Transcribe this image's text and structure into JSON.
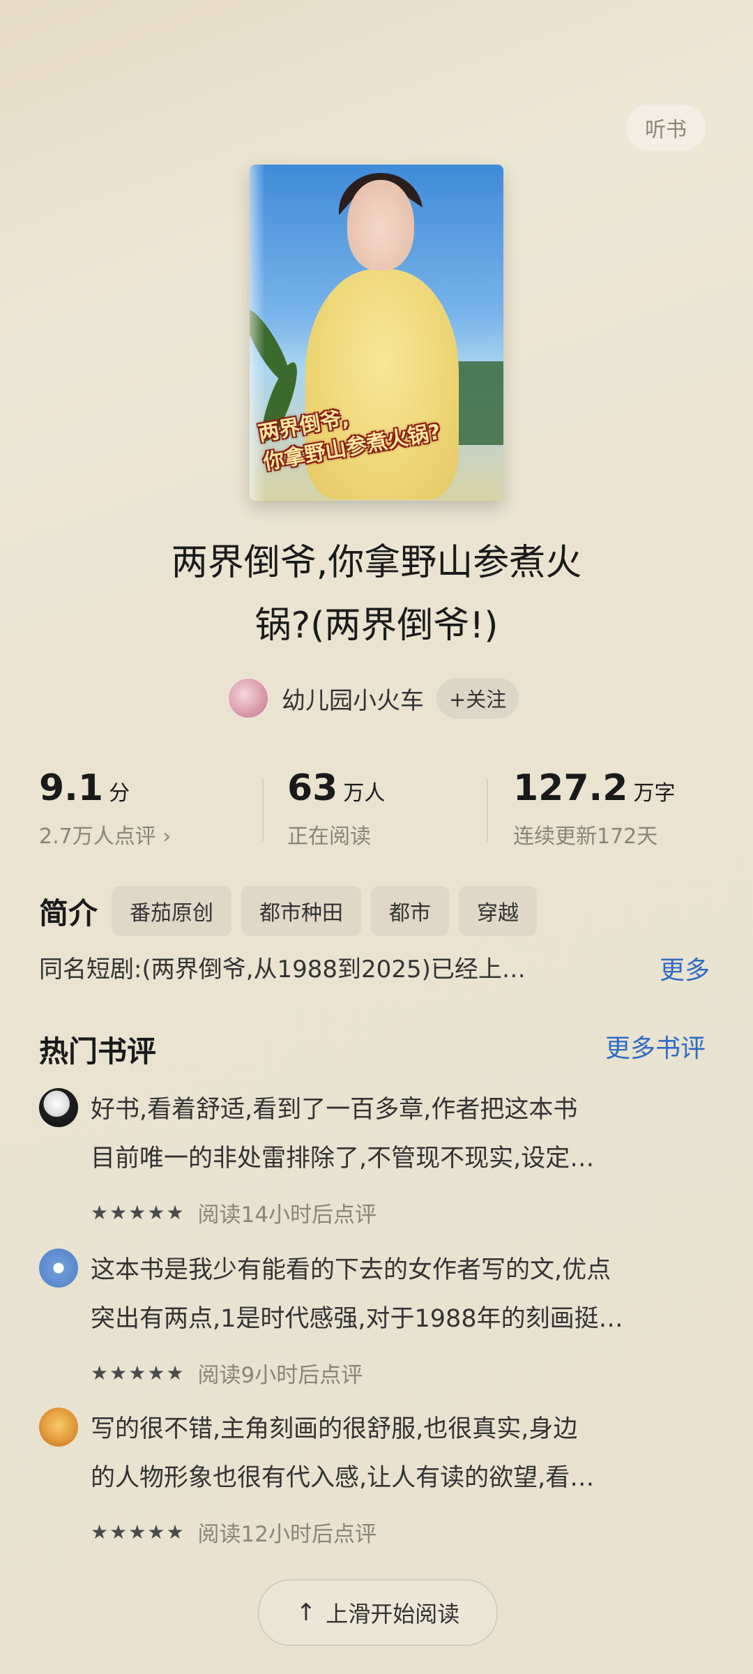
{
  "header": {
    "listen_label": "听书"
  },
  "cover": {
    "line1": "两界倒爷,",
    "line2": "你拿野山参煮火锅?"
  },
  "book": {
    "title_line1": "两界倒爷,你拿野山参煮火",
    "title_line2": "锅?(两界倒爷!)"
  },
  "author": {
    "name": "幼儿园小火车",
    "follow_label": "+关注"
  },
  "stats": {
    "rating": {
      "value": "9.1",
      "unit": "分",
      "sub": "2.7万人点评 ›"
    },
    "readers": {
      "value": "63",
      "unit": "万人",
      "sub": "正在阅读"
    },
    "words": {
      "value": "127.2",
      "unit": "万字",
      "sub": "连续更新172天"
    }
  },
  "intro": {
    "label": "简介",
    "tags": [
      "番茄原创",
      "都市种田",
      "都市",
      "穿越"
    ],
    "summary": "同名短剧:(两界倒爷,从1988到2025)已经上…",
    "more_label": "更多"
  },
  "reviews": {
    "section_title": "热门书评",
    "more_label": "更多书评",
    "items": [
      {
        "line1": "好书,看着舒适,看到了一百多章,作者把这本书",
        "line2": "目前唯一的非处雷排除了,不管现不现实,设定…",
        "meta": "阅读14小时后点评",
        "stars": 5
      },
      {
        "line1": "这本书是我少有能看的下去的女作者写的文,优点",
        "line2": "突出有两点,1是时代感强,对于1988年的刻画挺…",
        "meta": "阅读9小时后点评",
        "stars": 5
      },
      {
        "line1": "写的很不错,主角刻画的很舒服,也很真实,身边",
        "line2": "的人物形象也很有代入感,让人有读的欲望,看…",
        "meta": "阅读12小时后点评",
        "stars": 5
      }
    ]
  },
  "bottom": {
    "read_label": "上滑开始阅读"
  },
  "icons": {
    "star": "star-icon",
    "arrow": "arrow-up-icon"
  }
}
